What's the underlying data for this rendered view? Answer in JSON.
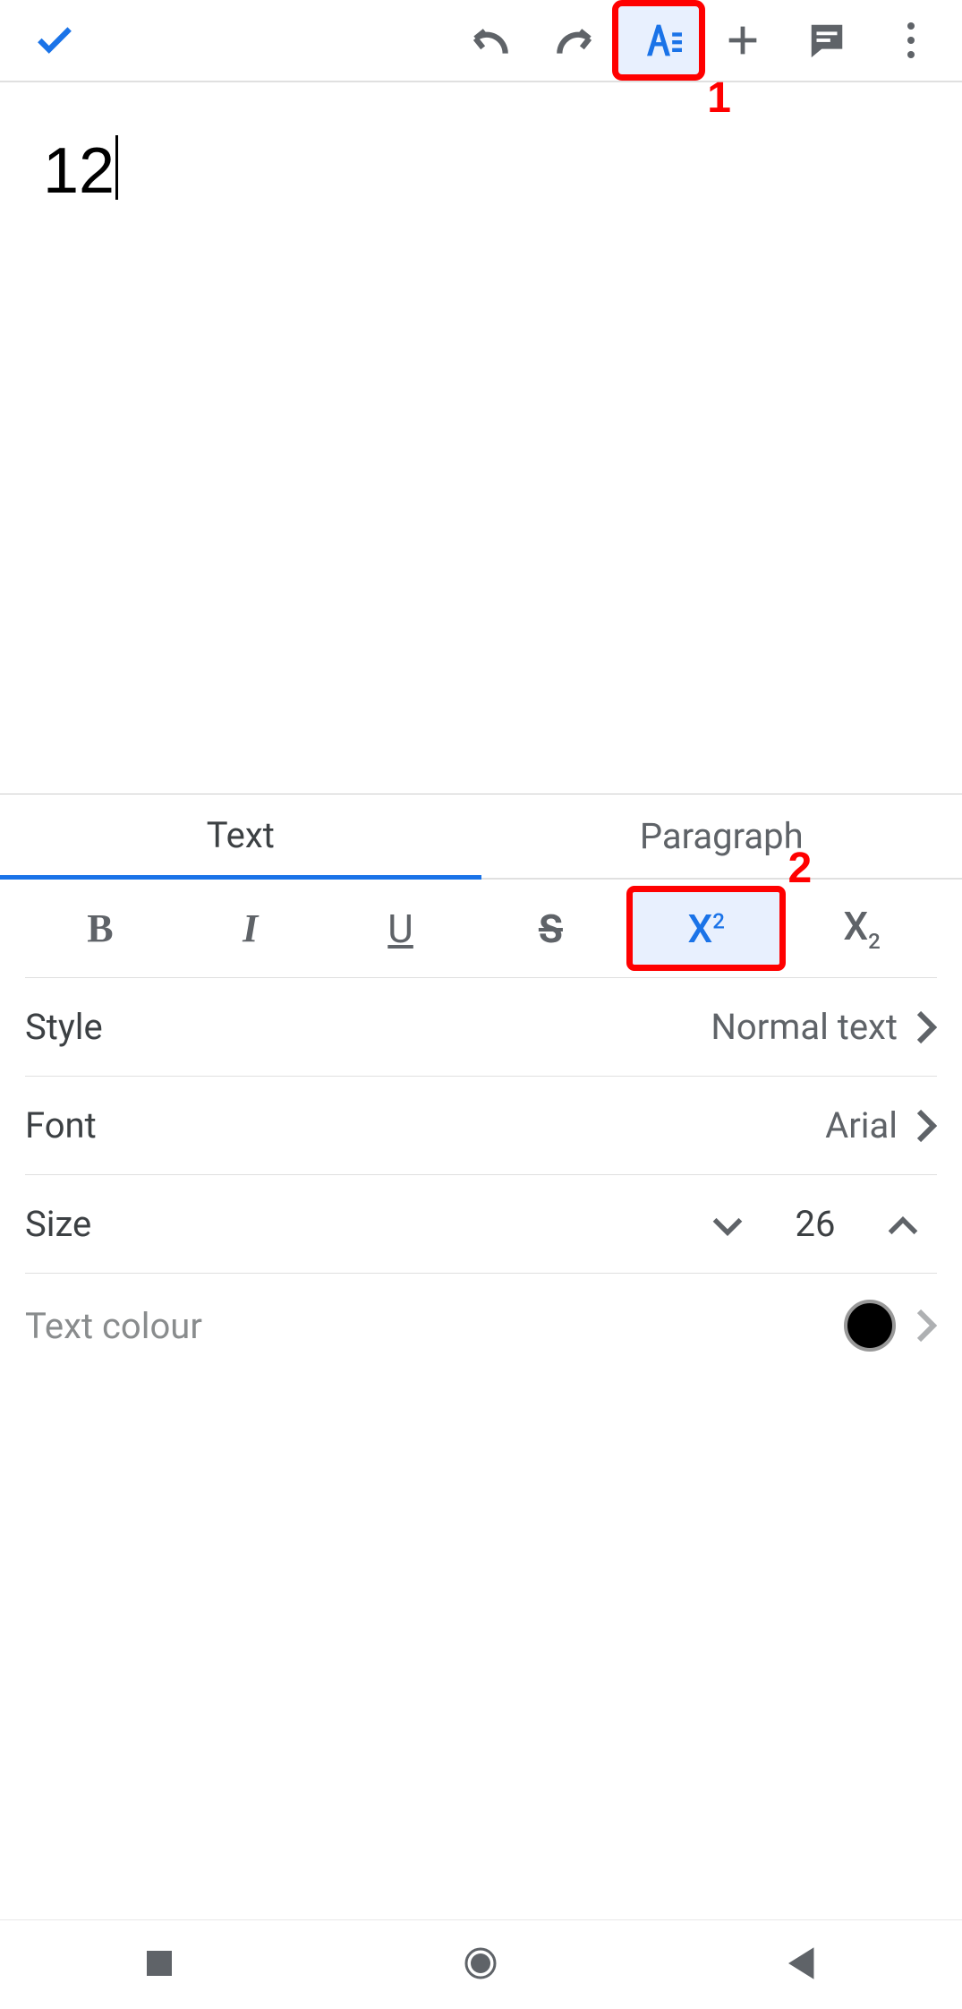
{
  "toolbar": {
    "done_icon": "done",
    "undo_icon": "undo",
    "redo_icon": "redo",
    "format_icon": "text-format",
    "insert_icon": "plus",
    "comment_icon": "comment",
    "menu_icon": "more-vert"
  },
  "document": {
    "content": "12"
  },
  "annotations": {
    "marker1": "1",
    "marker2": "2"
  },
  "panel": {
    "tabs": {
      "text": "Text",
      "paragraph": "Paragraph"
    },
    "format_buttons": {
      "bold": "B",
      "italic": "I",
      "underline": "U",
      "strike": "S",
      "sup": "X",
      "sup_exp": "2",
      "sub": "X",
      "sub_exp": "2"
    },
    "rows": {
      "style_label": "Style",
      "style_value": "Normal text",
      "font_label": "Font",
      "font_value": "Arial",
      "size_label": "Size",
      "size_value": "26",
      "colour_label": "Text colour"
    }
  }
}
